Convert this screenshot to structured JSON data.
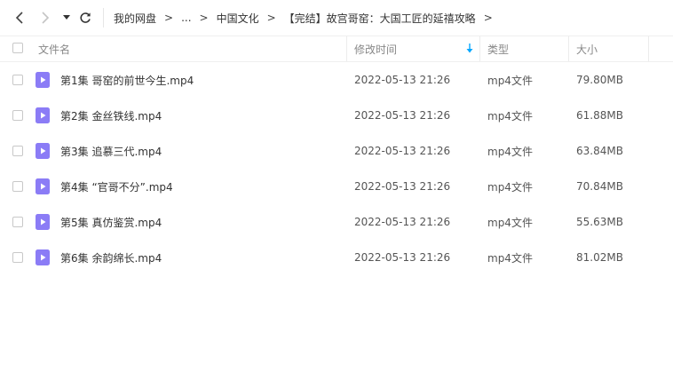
{
  "breadcrumb": [
    "我的网盘",
    "...",
    "中国文化",
    "【完结】故宫哥窑：大国工匠的延禧攻略"
  ],
  "breadcrumb_separator": ">",
  "columns": {
    "name": "文件名",
    "modified": "修改时间",
    "type": "类型",
    "size": "大小"
  },
  "sort": {
    "column": "modified",
    "direction": "descending"
  },
  "files": [
    {
      "name": "第1集 哥窑的前世今生.mp4",
      "modified": "2022-05-13 21:26",
      "type": "mp4文件",
      "size": "79.80MB"
    },
    {
      "name": "第2集 金丝铁线.mp4",
      "modified": "2022-05-13 21:26",
      "type": "mp4文件",
      "size": "61.88MB"
    },
    {
      "name": "第3集 追慕三代.mp4",
      "modified": "2022-05-13 21:26",
      "type": "mp4文件",
      "size": "63.84MB"
    },
    {
      "name": "第4集 “官哥不分”.mp4",
      "modified": "2022-05-13 21:26",
      "type": "mp4文件",
      "size": "70.84MB"
    },
    {
      "name": "第5集 真仿鉴赏.mp4",
      "modified": "2022-05-13 21:26",
      "type": "mp4文件",
      "size": "55.63MB"
    },
    {
      "name": "第6集 余韵绵长.mp4",
      "modified": "2022-05-13 21:26",
      "type": "mp4文件",
      "size": "81.02MB"
    }
  ],
  "icons": {
    "back": "chevron-left-icon",
    "forward": "chevron-right-icon",
    "history": "caret-down-icon",
    "refresh": "refresh-icon",
    "sort": "sort-down-arrow-icon",
    "file": "video-file-icon"
  },
  "colors": {
    "accent": "#06a7ff",
    "video_icon": "#8b7cf6"
  }
}
